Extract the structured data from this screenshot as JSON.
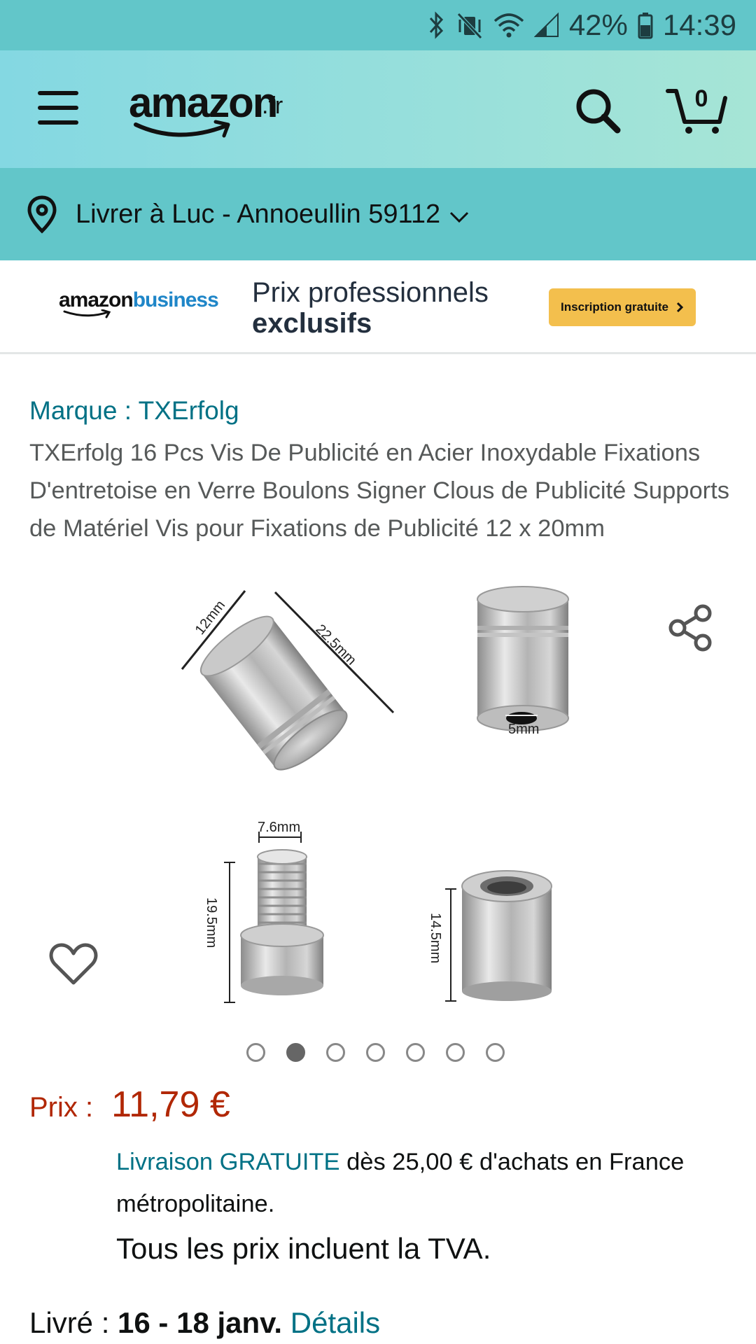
{
  "status_bar": {
    "battery": "42%",
    "time": "14:39",
    "icons": [
      "bluetooth-icon",
      "vibrate-off-icon",
      "wifi-icon",
      "signal-icon",
      "battery-icon"
    ]
  },
  "header": {
    "logo_text": "amazon",
    "logo_tld": ".fr",
    "cart_count": "0",
    "colors": {
      "gradient_start": "#84d8e2",
      "gradient_end": "#a6e5d6"
    }
  },
  "location": {
    "text": "Livrer à Luc - Annoeullin 59112"
  },
  "business_banner": {
    "logo_amazon": "amazon",
    "logo_business": "business",
    "line1": "Prix professionnels",
    "line2": "exclusifs",
    "button_label": "Inscription gratuite"
  },
  "product": {
    "brand_link": "Marque : TXErfolg",
    "title": "TXErfolg 16 Pcs Vis De Publicité en Acier Inoxydable Fixations D'entretoise en Verre Boulons Signer Clous de Publicité Supports de Matériel Vis pour Fixations de Publicité 12 x 20mm",
    "image_labels": {
      "cap_diameter": "12mm",
      "cap_length": "22.5mm",
      "hole": "5mm",
      "screw_width": "7.6mm",
      "screw_length": "19.5mm",
      "base_length": "14.5mm"
    },
    "carousel": {
      "count": 7,
      "active_index": 1
    }
  },
  "price": {
    "label": "Prix :",
    "value": "11,79 €"
  },
  "delivery": {
    "link_text": "Livraison GRATUITE",
    "rest": " dès 25,00 € d'achats en France métropolitaine.",
    "tva": "Tous les prix incluent la TVA."
  },
  "delivery_date": {
    "label": "Livré : ",
    "dates": "16 - 18 janv.",
    "details_link": "Détails"
  }
}
